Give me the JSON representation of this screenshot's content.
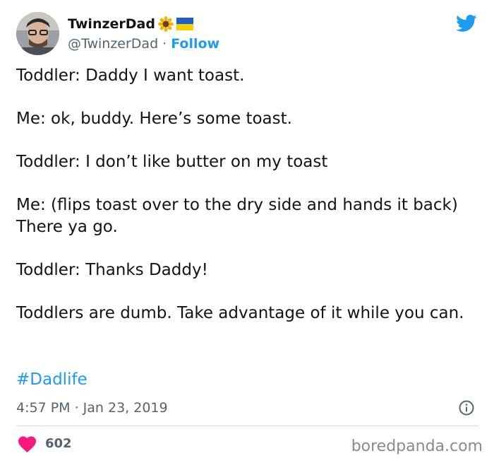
{
  "author": {
    "display_name": "TwinzerDad",
    "handle": "@TwinzerDad",
    "separator": "·",
    "follow_label": "Follow",
    "badges": [
      "sunflower-icon",
      "ukraine-flag-icon"
    ]
  },
  "tweet": {
    "paragraphs": [
      "Toddler: Daddy I want toast.",
      "Me: ok, buddy. Here’s some toast.",
      "Toddler: I don’t like butter on my toast",
      "Me: (flips toast over to the dry side and hands it back) There ya go.",
      "Toddler: Thanks Daddy!",
      "Toddlers are dumb. Take advantage of it while you can."
    ],
    "hashtag": "#Dadlife",
    "timestamp": "4:57 PM · Jan 23, 2019",
    "like_count": "602"
  },
  "watermark": "boredpanda.com",
  "colors": {
    "accent": "#1d9bf0",
    "like": "#f91880",
    "text": "#0f1419",
    "secondary": "#536471"
  }
}
